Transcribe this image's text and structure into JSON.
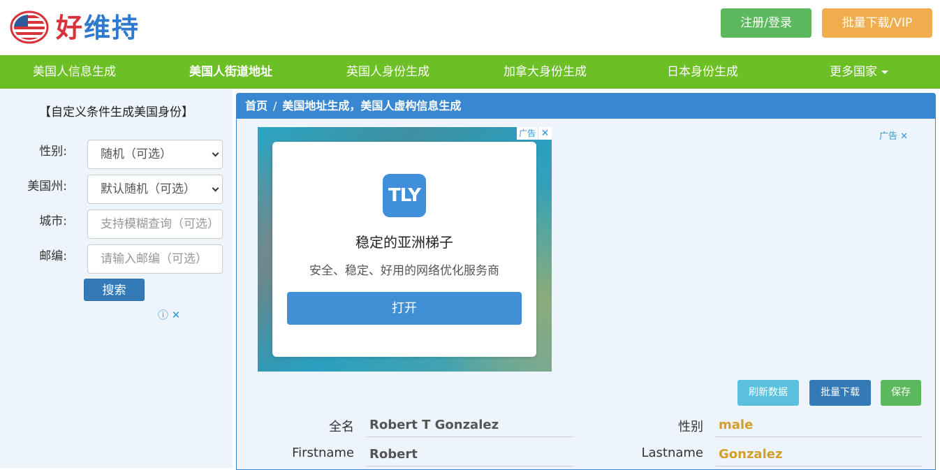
{
  "header": {
    "logo_text_red": "好",
    "logo_text_blue": "维持",
    "login_label": "注册/登录",
    "vip_label": "批量下载/VIP"
  },
  "nav": {
    "items": [
      {
        "label": "美国人信息生成"
      },
      {
        "label": "美国人街道地址"
      },
      {
        "label": "英国人身份生成"
      },
      {
        "label": "加拿大身份生成"
      },
      {
        "label": "日本身份生成"
      },
      {
        "label": "更多国家"
      }
    ]
  },
  "sidebar": {
    "title": "【自定义条件生成美国身份】",
    "gender_label": "性别:",
    "gender_value": "随机（可选）",
    "state_label": "美国州:",
    "state_value": "默认随机（可选）",
    "city_label": "城市:",
    "city_placeholder": "支持模糊查询（可选）",
    "zip_label": "邮编:",
    "zip_placeholder": "请输入邮编（可选）",
    "search_label": "搜索"
  },
  "breadcrumb": {
    "home": "首页",
    "sep": "/",
    "current": "美国地址生成，美国人虚构信息生成"
  },
  "ad": {
    "tag": "广告",
    "close": "✕",
    "logo": "TLY",
    "title": "稳定的亚洲梯子",
    "subtitle": "安全、稳定、好用的网络优化服务商",
    "open_label": "打开",
    "main_tag": "广告 ✕"
  },
  "actions": {
    "refresh": "刷新数据",
    "batch": "批量下载",
    "save": "保存"
  },
  "fields": {
    "fullname_label": "全名",
    "fullname_value": "Robert T Gonzalez",
    "gender_label": "性别",
    "gender_value": "male",
    "firstname_label": "Firstname",
    "firstname_value": "Robert",
    "lastname_label": "Lastname",
    "lastname_value": "Gonzalez"
  },
  "colors": {
    "nav_green": "#6cbf25",
    "primary_blue": "#3a87d1",
    "gold": "#d39e2a"
  }
}
